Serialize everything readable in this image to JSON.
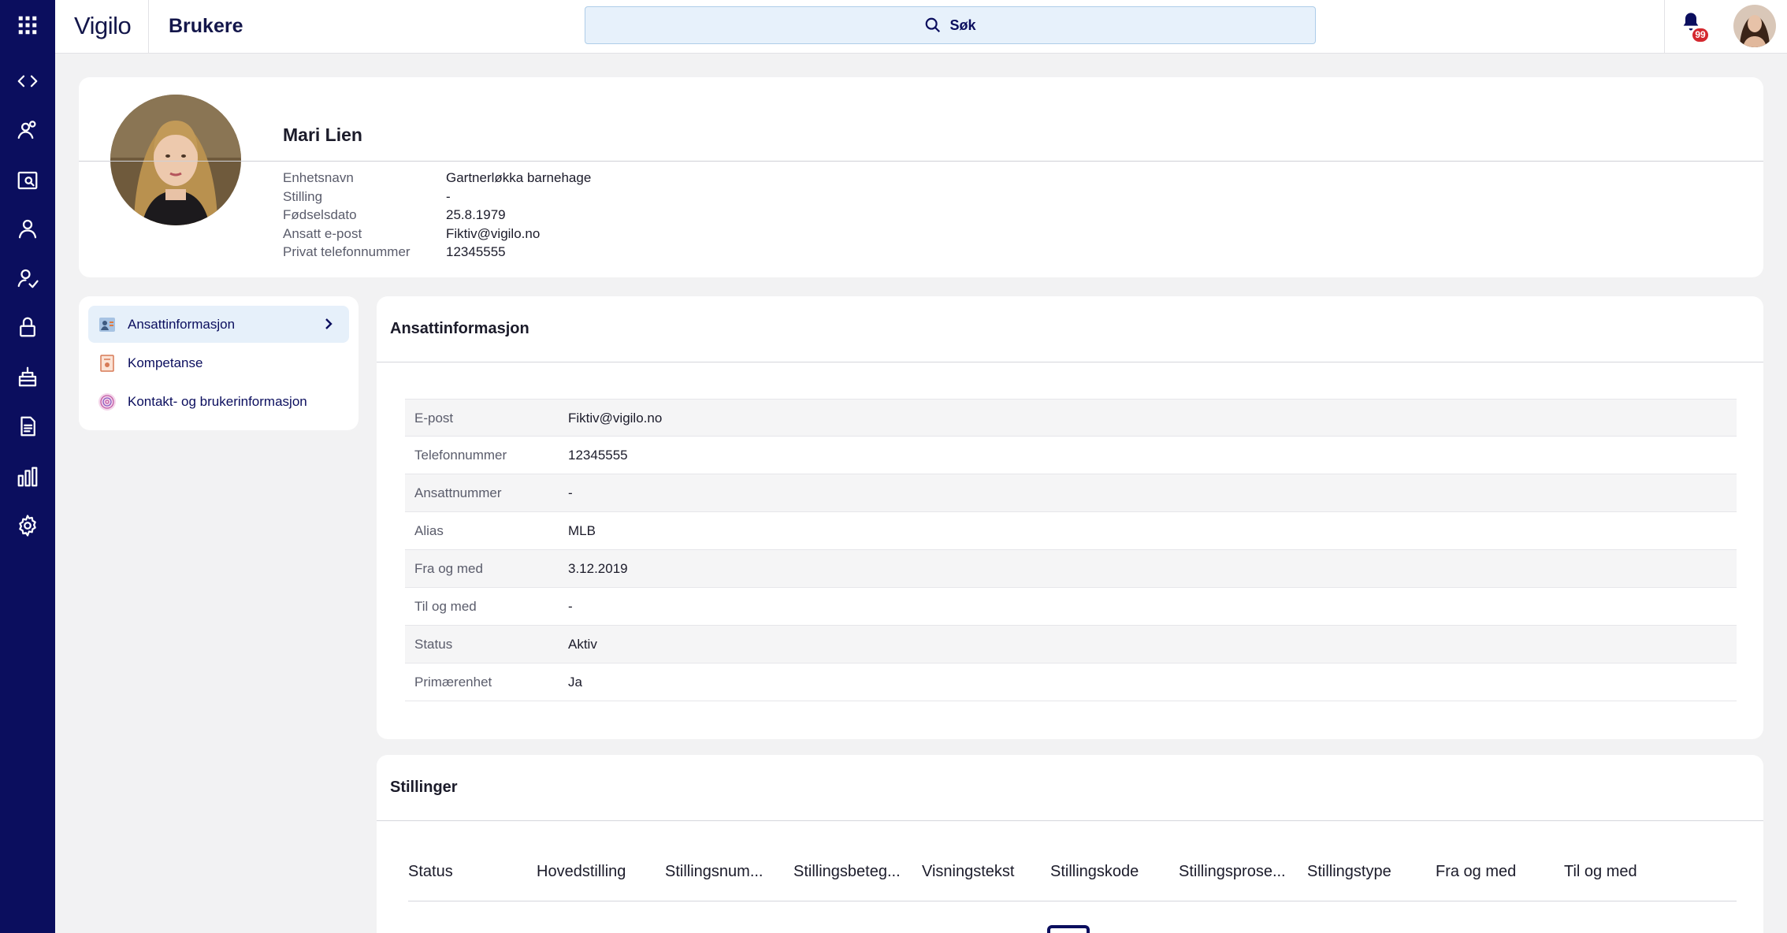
{
  "app": {
    "brand": "Vigilo",
    "page_title": "Brukere",
    "search_label": "Søk",
    "notification_count": "99",
    "accent_color": "#0b0e5e",
    "search_bg_color": "#e7f1fb",
    "badge_color": "#d4282f"
  },
  "sidebar": {
    "items": [
      {
        "icon": "apps-grid-icon"
      },
      {
        "icon": "code-icon"
      },
      {
        "icon": "users-group-icon"
      },
      {
        "icon": "user-search-icon"
      },
      {
        "icon": "user-icon"
      },
      {
        "icon": "user-check-icon"
      },
      {
        "icon": "lock-icon"
      },
      {
        "icon": "building-icon"
      },
      {
        "icon": "document-icon"
      },
      {
        "icon": "bar-chart-icon"
      },
      {
        "icon": "gear-icon"
      }
    ]
  },
  "profile": {
    "name": "Mari Lien",
    "details": [
      {
        "label": "Enhetsnavn",
        "value": "Gartnerløkka barnehage"
      },
      {
        "label": "Stilling",
        "value": "-"
      },
      {
        "label": "Fødselsdato",
        "value": "25.8.1979"
      },
      {
        "label": "Ansatt e-post",
        "value": "Fiktiv@vigilo.no"
      },
      {
        "label": "Privat telefonnummer",
        "value": "12345555"
      }
    ]
  },
  "menu": {
    "items": [
      {
        "label": "Ansattinformasjon",
        "active": true
      },
      {
        "label": "Kompetanse",
        "active": false
      },
      {
        "label": "Kontakt- og brukerinformasjon",
        "active": false
      }
    ]
  },
  "employee_info": {
    "title": "Ansattinformasjon",
    "rows": [
      {
        "label": "E-post",
        "value": "Fiktiv@vigilo.no"
      },
      {
        "label": "Telefonnummer",
        "value": "12345555"
      },
      {
        "label": "Ansattnummer",
        "value": "-"
      },
      {
        "label": "Alias",
        "value": "MLB"
      },
      {
        "label": "Fra og med",
        "value": "3.12.2019"
      },
      {
        "label": "Til og med",
        "value": "-"
      },
      {
        "label": "Status",
        "value": "Aktiv"
      },
      {
        "label": "Primærenhet",
        "value": "Ja"
      }
    ]
  },
  "positions": {
    "title": "Stillinger",
    "columns": [
      "Status",
      "Hovedstilling",
      "Stillingsnum...",
      "Stillingsbeteg...",
      "Visningstekst",
      "Stillingskode",
      "Stillingsprose...",
      "Stillingstype",
      "Fra og med",
      "Til og med"
    ]
  }
}
